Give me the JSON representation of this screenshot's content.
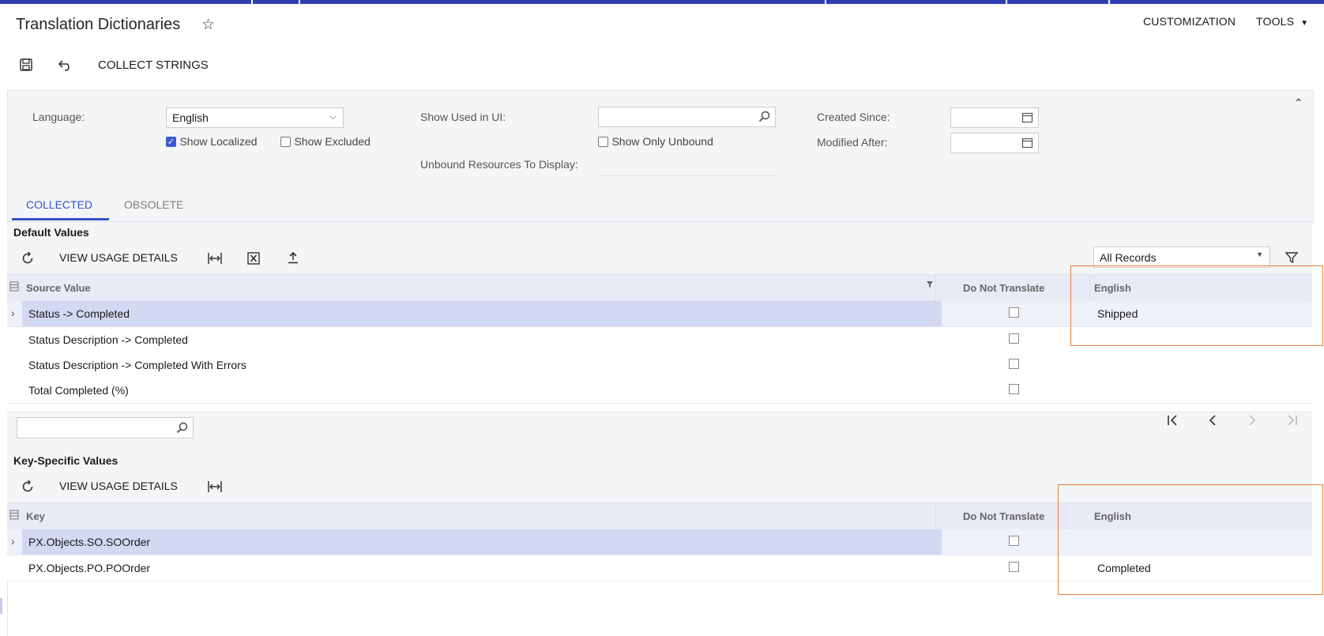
{
  "header": {
    "title": "Translation Dictionaries",
    "customization": "CUSTOMIZATION",
    "tools": "TOOLS"
  },
  "toolbar": {
    "collect_strings": "COLLECT STRINGS"
  },
  "filters": {
    "language_label": "Language:",
    "language_value": "English",
    "show_localized": "Show Localized",
    "show_excluded": "Show Excluded",
    "show_used_label": "Show Used in UI:",
    "show_only_unbound": "Show Only Unbound",
    "unbound_label": "Unbound Resources To Display:",
    "created_since_label": "Created Since:",
    "modified_after_label": "Modified After:"
  },
  "tabs": [
    "COLLECTED",
    "OBSOLETE"
  ],
  "default_values": {
    "title": "Default Values",
    "view_usage": "VIEW USAGE DETAILS",
    "records_filter": "All Records",
    "columns": {
      "source": "Source Value",
      "dnt": "Do Not Translate",
      "english": "English"
    },
    "rows": [
      {
        "source": "Status -> Completed",
        "english": "Shipped"
      },
      {
        "source": "Status Description -> Completed",
        "english": ""
      },
      {
        "source": "Status Description -> Completed With Errors",
        "english": ""
      },
      {
        "source": "Total Completed (%)",
        "english": ""
      }
    ]
  },
  "key_values": {
    "title": "Key-Specific Values",
    "view_usage": "VIEW USAGE DETAILS",
    "columns": {
      "key": "Key",
      "dnt": "Do Not Translate",
      "english": "English"
    },
    "rows": [
      {
        "key": "PX.Objects.SO.SOOrder",
        "english": ""
      },
      {
        "key": "PX.Objects.PO.POOrder",
        "english": "Completed"
      }
    ]
  },
  "colors": {
    "accent": "#2f3fb3",
    "highlight": "#e67e37",
    "selected_row": "#d3d8f3"
  }
}
